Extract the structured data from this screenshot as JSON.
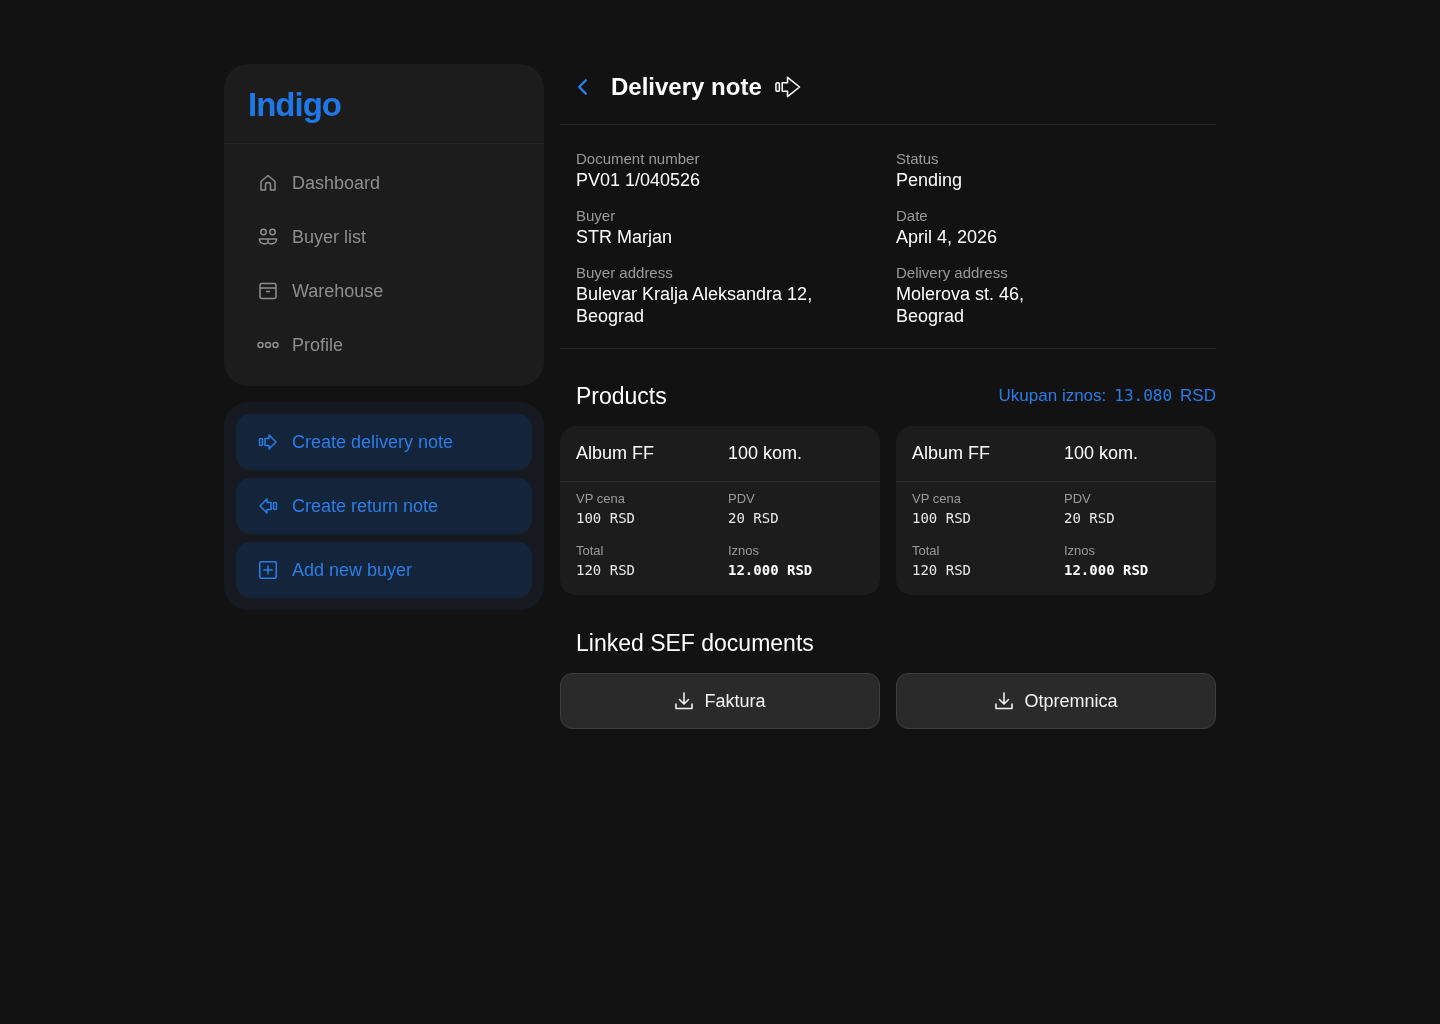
{
  "sidebar": {
    "logo": "Indigo",
    "nav": [
      {
        "label": "Dashboard",
        "selected": false
      },
      {
        "label": "Buyer list",
        "selected": false
      },
      {
        "label": "Warehouse",
        "selected": false
      },
      {
        "label": "Profile",
        "selected": false
      }
    ],
    "actions": [
      {
        "label": "Create delivery note"
      },
      {
        "label": "Create return note"
      },
      {
        "label": "Add new buyer"
      }
    ]
  },
  "header": {
    "title": "Delivery note"
  },
  "details": [
    {
      "label": "Document number",
      "value": "PV01 1/040526"
    },
    {
      "label": "Status",
      "value": "Pending"
    },
    {
      "label": "Buyer",
      "value": "STR Marjan"
    },
    {
      "label": "Date",
      "value": "April 4, 2026"
    },
    {
      "label": "Buyer address",
      "value": "Bulevar Kralja Aleksandra 12,\nBeograd"
    },
    {
      "label": "Delivery address",
      "value": "Molerova st. 46,\nBeograd"
    }
  ],
  "products": {
    "title": "Products",
    "total_label": "Ukupan iznos:",
    "total_amount": "13.080",
    "total_currency": "RSD",
    "items": [
      {
        "name": "Album FF",
        "quantity": "100 kom.",
        "fields": [
          {
            "label": "VP cena",
            "value": "100 RSD",
            "kind": "plain"
          },
          {
            "label": "PDV",
            "value": "20 RSD",
            "kind": "plain"
          },
          {
            "label": "Total",
            "value": "120 RSD",
            "kind": "plain"
          },
          {
            "label": "Iznos",
            "value": "12.000 RSD",
            "kind": "strong"
          }
        ]
      },
      {
        "name": "Album FF",
        "quantity": "100 kom.",
        "fields": [
          {
            "label": "VP cena",
            "value": "100 RSD",
            "kind": "plain"
          },
          {
            "label": "PDV",
            "value": "20 RSD",
            "kind": "plain"
          },
          {
            "label": "Total",
            "value": "120 RSD",
            "kind": "plain"
          },
          {
            "label": "Iznos",
            "value": "12.000 RSD",
            "kind": "strong"
          }
        ]
      }
    ]
  },
  "linked_documents": {
    "title": "Linked SEF documents",
    "files": [
      "Faktura",
      "Otpremnica"
    ]
  }
}
